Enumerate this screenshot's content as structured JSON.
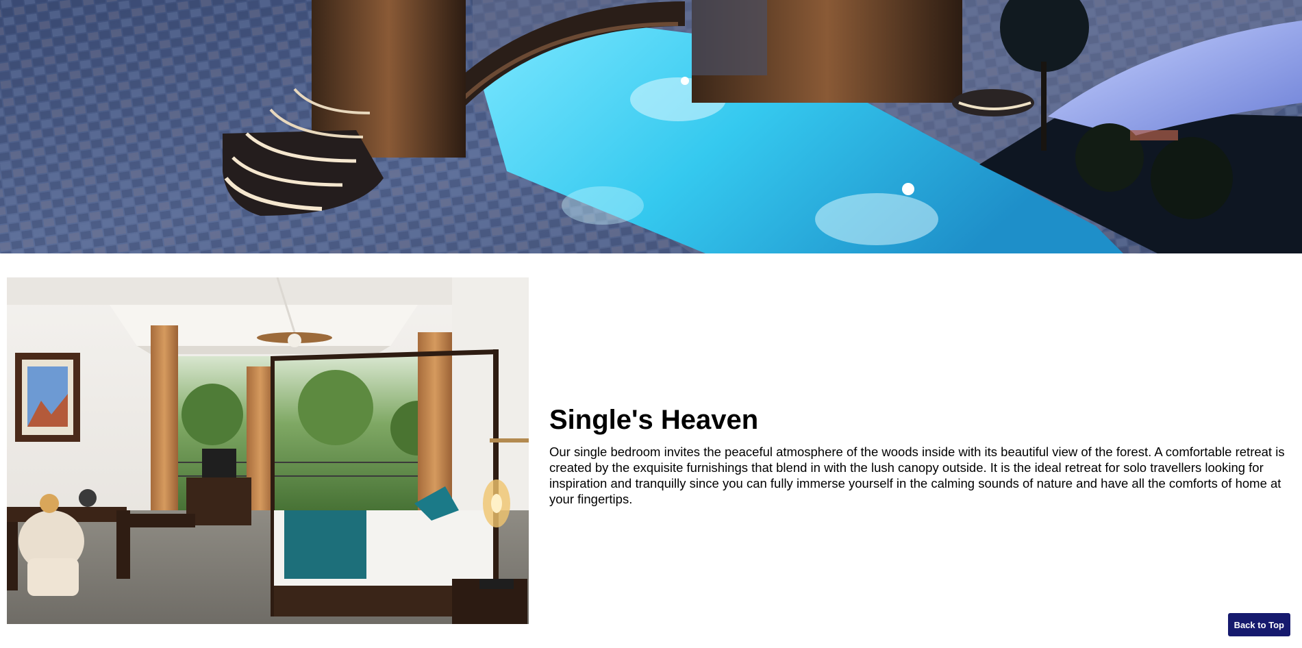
{
  "hero": {
    "image": "resort-pool-night-photo",
    "icon": "pool-image"
  },
  "room": {
    "image": "single-bedroom-photo",
    "title": "Single's Heaven",
    "description": "Our single bedroom invites the peaceful atmosphere of the woods inside with its beautiful view of the forest. A comfortable retreat is created by the exquisite furnishings that blend in with the lush canopy outside. It is the ideal retreat for solo travellers looking for inspiration and tranquilly since you can fully immerse yourself in the calming sounds of nature and have all the comforts of home at your fingertips."
  },
  "back_to_top": {
    "label": "Back to Top",
    "color": "#161a6e"
  },
  "colors": {
    "pool": "#3fd2f2",
    "paving": "#4a5a82",
    "wood": "#5a3f2b"
  }
}
